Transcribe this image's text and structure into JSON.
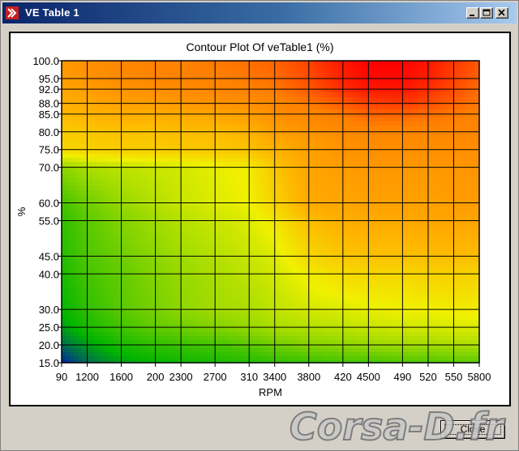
{
  "window": {
    "title": "VE Table 1",
    "close_button_label": "Close"
  },
  "watermark": {
    "text": "Corsa-D.fr"
  },
  "chart_data": {
    "type": "heatmap",
    "title": "Contour Plot Of veTable1 (%)",
    "xlabel": "RPM",
    "ylabel": "%",
    "x": [
      900,
      1200,
      1600,
      2000,
      2300,
      2700,
      3100,
      3400,
      3800,
      4200,
      4500,
      4900,
      5200,
      5500,
      5800
    ],
    "x_tick_labels": [
      "90",
      "1200",
      "1600",
      "200",
      "2300",
      "2700",
      "310",
      "3400",
      "3800",
      "420",
      "4500",
      "490",
      "520",
      "550",
      "5800"
    ],
    "y": [
      15.0,
      20.0,
      25.0,
      30.0,
      40.0,
      45.0,
      55.0,
      60.0,
      70.0,
      75.0,
      80.0,
      85.0,
      88.0,
      92.0,
      95.0,
      100.0
    ],
    "y_tick_labels": [
      "15.0",
      "20.0",
      "25.0",
      "30.0",
      "40.0",
      "45.0",
      "55.0",
      "60.0",
      "70.0",
      "75.0",
      "80.0",
      "85.0",
      "88.0",
      "92.0",
      "95.0",
      "100.0"
    ],
    "xlim": [
      900,
      5800
    ],
    "ylim": [
      15.0,
      100.0
    ],
    "grid": true,
    "colorscale": [
      "#0000c8",
      "#00b400",
      "#7dd200",
      "#f0f000",
      "#ffb400",
      "#ff8000",
      "#ff0000"
    ],
    "value_range": [
      30,
      100
    ],
    "z": [
      [
        32,
        37,
        40,
        42,
        43,
        44,
        45,
        46,
        47,
        48,
        48,
        49,
        49,
        50,
        50
      ],
      [
        37,
        40,
        44,
        46,
        47,
        48,
        50,
        52,
        54,
        55,
        56,
        57,
        57,
        58,
        58
      ],
      [
        40,
        44,
        48,
        51,
        52,
        54,
        56,
        58,
        59,
        60,
        61,
        62,
        62,
        63,
        63
      ],
      [
        42,
        46,
        50,
        53,
        55,
        57,
        58,
        60,
        62,
        63,
        64,
        65,
        65,
        66,
        66
      ],
      [
        44,
        48,
        51,
        54,
        56,
        58,
        60,
        62,
        66,
        69,
        70,
        70,
        71,
        71,
        71
      ],
      [
        45,
        49,
        52,
        55,
        57,
        59,
        61,
        63,
        70,
        73,
        74,
        74,
        75,
        75,
        75
      ],
      [
        46,
        50,
        54,
        57,
        59,
        61,
        63,
        67,
        75,
        78,
        79,
        79,
        80,
        80,
        80
      ],
      [
        48,
        52,
        56,
        59,
        61,
        63,
        65,
        71,
        79,
        80,
        81,
        81,
        81,
        82,
        82
      ],
      [
        55,
        58,
        60,
        61,
        62,
        64,
        66,
        73,
        80,
        82,
        83,
        83,
        83,
        83,
        84
      ],
      [
        70,
        71,
        72,
        72,
        73,
        73,
        74,
        77,
        81,
        84,
        85,
        85,
        85,
        85,
        85
      ],
      [
        72,
        73,
        74,
        74,
        75,
        75,
        77,
        81,
        84,
        86,
        87,
        87,
        87,
        87,
        87
      ],
      [
        76,
        77,
        78,
        78,
        79,
        80,
        82,
        85,
        87,
        89,
        91,
        91,
        90,
        89,
        88
      ],
      [
        78,
        79,
        81,
        82,
        83,
        84,
        85,
        87,
        89,
        92,
        94,
        95,
        93,
        91,
        89
      ],
      [
        80,
        82,
        84,
        85,
        86,
        87,
        88,
        89,
        92,
        96,
        98,
        98,
        96,
        93,
        90
      ],
      [
        82,
        84,
        86,
        87,
        88,
        88,
        89,
        90,
        93,
        97,
        99,
        99,
        97,
        94,
        91
      ],
      [
        83,
        85,
        87,
        88,
        88,
        89,
        90,
        91,
        94,
        98,
        100,
        100,
        98,
        95,
        92
      ]
    ]
  }
}
